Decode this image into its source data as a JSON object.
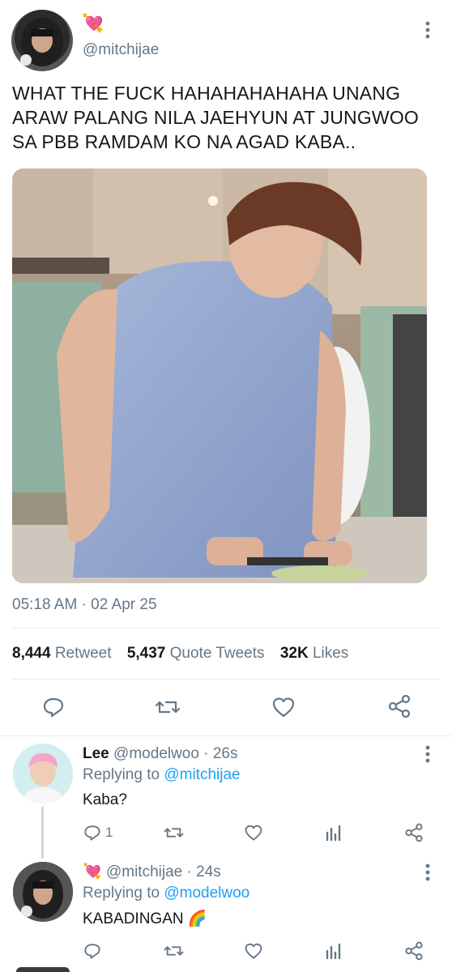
{
  "tweet": {
    "handle": "@mitchijae",
    "name_emoji": "💘",
    "text": "WHAT THE FUCK HAHAHAHAHAHA UNANG ARAW PALANG NILA JAEHYUN AT JUNGWOO SA PBB RAMDAM KO NA AGAD KABA..",
    "timestamp": "05:18 AM · 02 Apr 25",
    "stats": {
      "retweets": "8,444",
      "retweets_label": "Retweet",
      "quotes": "5,437",
      "quotes_label": "Quote Tweets",
      "likes": "32K",
      "likes_label": "Likes"
    }
  },
  "replies": [
    {
      "name": "Lee",
      "handle": "@modelwoo",
      "time": "· 26s",
      "replying_prefix": "Replying to",
      "replying_to": "@mitchijae",
      "text": "Kaba?",
      "reply_count": "1"
    },
    {
      "name_emoji": "💘",
      "handle": "@mitchijae",
      "time": "· 24s",
      "replying_prefix": "Replying to",
      "replying_to": "@modelwoo",
      "text": "KABADINGAN 🌈"
    }
  ],
  "icons": {
    "more": "more-vertical-icon",
    "reply": "reply-icon",
    "retweet": "retweet-icon",
    "like": "heart-icon",
    "share": "share-icon",
    "analytics": "analytics-icon"
  },
  "colors": {
    "link": "#1da1f2",
    "muted": "#657786",
    "text": "#14171a"
  }
}
